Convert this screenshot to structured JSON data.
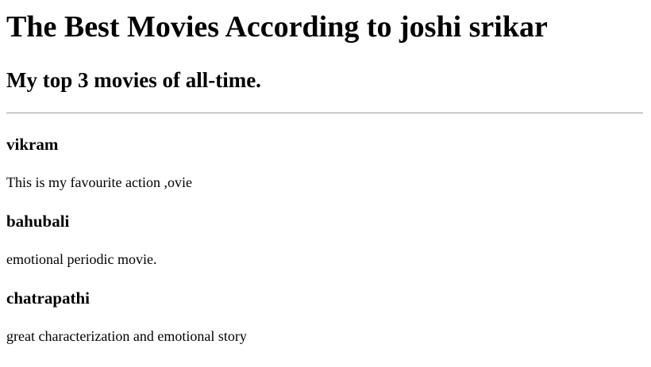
{
  "page": {
    "title": "The Best Movies According to joshi srikar",
    "subtitle": "My top 3 movies of all-time."
  },
  "movies": [
    {
      "title": "vikram",
      "description": "This is my favourite action ,ovie"
    },
    {
      "title": "bahubali",
      "description": "emotional periodic movie."
    },
    {
      "title": "chatrapathi",
      "description": "great characterization and emotional story"
    }
  ]
}
